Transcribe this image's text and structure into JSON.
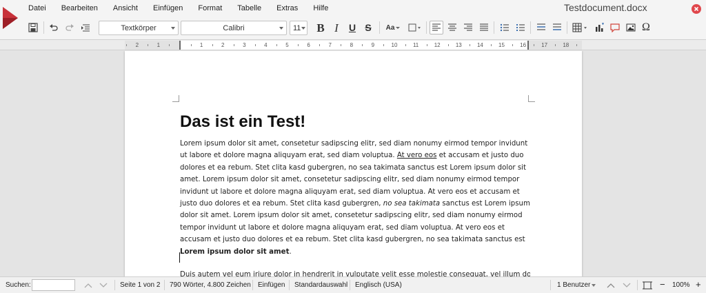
{
  "app": {
    "document_title": "Testdocument.docx"
  },
  "menu": [
    "Datei",
    "Bearbeiten",
    "Ansicht",
    "Einfügen",
    "Format",
    "Tabelle",
    "Extras",
    "Hilfe"
  ],
  "toolbar": {
    "paragraph_style": "Textkörper",
    "font_name": "Calibri",
    "font_size": "11",
    "bold_label": "B",
    "italic_label": "I",
    "underline_label": "U",
    "strike_label": "S",
    "case_label": "Aa",
    "special_char_label": "Ω"
  },
  "ruler": {
    "left_numbers": [
      "2",
      "1"
    ],
    "numbers": [
      "1",
      "2",
      "3",
      "4",
      "5",
      "6",
      "7",
      "8",
      "9",
      "10",
      "11",
      "12",
      "13",
      "14",
      "15",
      "16"
    ],
    "right_numbers": [
      "17",
      "18"
    ]
  },
  "document": {
    "heading": "Das ist ein Test!",
    "p1_a": "Lorem ipsum dolor sit amet, consetetur sadipscing elitr, sed diam nonumy eirmod tempor invidunt ut labore et dolore magna aliquyam erat, sed diam voluptua. ",
    "p1_underlined": "At vero eos",
    "p1_b": " et accusam et justo duo dolores et ea rebum. Stet clita kasd gubergren, no sea takimata sanctus est Lorem ipsum dolor sit amet. Lorem ipsum dolor sit amet, consetetur sadipscing elitr, sed diam nonumy eirmod tempor invidunt ut labore et dolore magna aliquyam erat, sed diam voluptua. At vero eos et accusam et justo duo dolores et ea rebum. Stet clita kasd gubergren, ",
    "p1_italic": "no sea takimata",
    "p1_c": " sanctus est Lorem ipsum dolor sit amet. Lorem ipsum dolor sit amet, consetetur sadipscing elitr, sed diam nonumy eirmod tempor invidunt ut labore et dolore magna aliquyam erat, sed diam voluptua. At vero eos et accusam et justo duo dolores et ea rebum. Stet clita kasd gubergren, no sea takimata sanctus est ",
    "p1_bold": "Lorem ipsum dolor sit amet",
    "p1_end": ".",
    "p2": "Duis autem vel eum iriure dolor in hendrerit in vulputate velit esse molestie consequat, vel illum dolore"
  },
  "status": {
    "search_label": "Suchen:",
    "search_value": "",
    "page": "Seite 1 von 2",
    "counts": "790 Wörter, 4.800 Zeichen",
    "mode": "Einfügen",
    "selection": "Standardauswahl",
    "language": "Englisch (USA)",
    "users": "1 Benutzer",
    "zoom": "100%",
    "zoom_minus": "−",
    "zoom_plus": "+"
  },
  "colors": {
    "accent": "#c8323a",
    "close": "#e0474c"
  }
}
